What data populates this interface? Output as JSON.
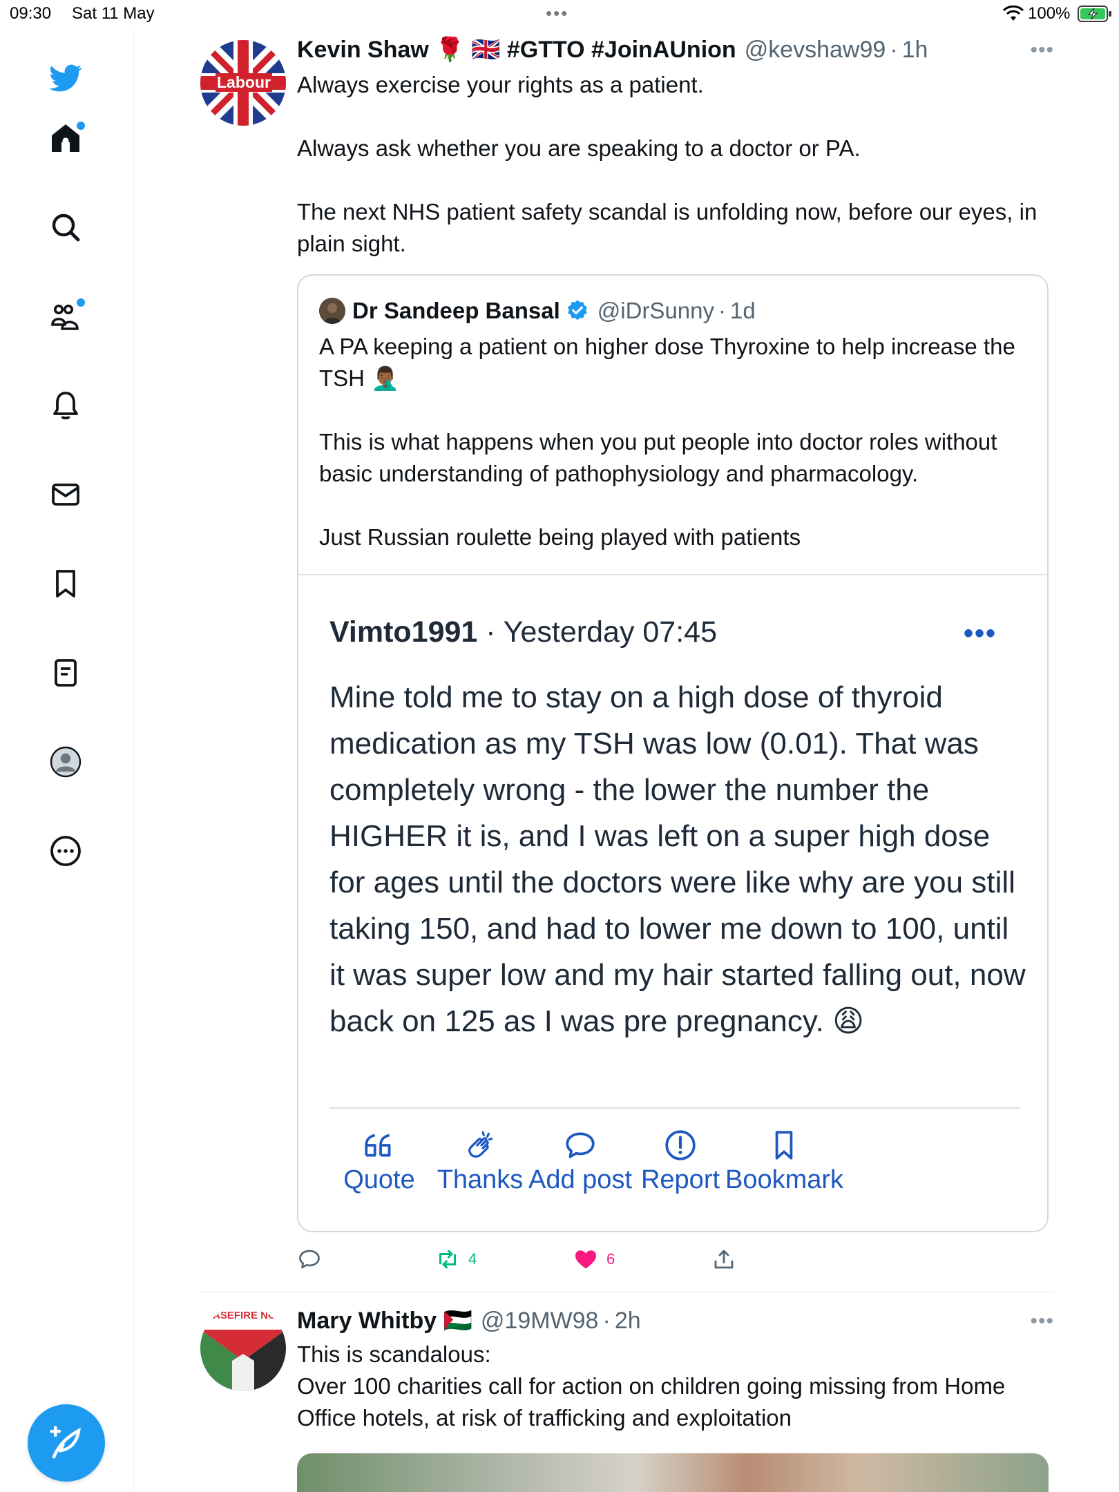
{
  "status_bar": {
    "time": "09:30",
    "date": "Sat 11 May",
    "battery": "100%"
  },
  "colors": {
    "twitter_blue": "#1d9bf0",
    "retweet_green": "#00ba7c",
    "like_pink": "#f91880",
    "embed_blue": "#1d58c2"
  },
  "sidebar": {
    "items": [
      {
        "icon": "twitter-bird-icon"
      },
      {
        "icon": "home-icon"
      },
      {
        "icon": "search-icon"
      },
      {
        "icon": "communities-icon"
      },
      {
        "icon": "notifications-icon"
      },
      {
        "icon": "messages-icon"
      },
      {
        "icon": "bookmarks-icon"
      },
      {
        "icon": "lists-icon"
      },
      {
        "icon": "profile-icon"
      },
      {
        "icon": "more-icon"
      }
    ],
    "compose_icon": "compose-feather-icon"
  },
  "tweet1": {
    "name": "Kevin Shaw 🌹 🇬🇧 #GTTO #JoinAUnion",
    "handle": "@kevshaw99",
    "time": "1h",
    "avatar_text": "Labour",
    "text": "Always exercise your rights as a patient.\n\nAlways ask whether you are speaking to a doctor or PA.\n\nThe next NHS patient safety scandal is unfolding now, before our eyes, in plain sight.",
    "quote": {
      "name": "Dr Sandeep Bansal",
      "handle": "@iDrSunny",
      "time": "1d",
      "text": "A PA keeping a patient on higher dose Thyroxine to help increase the TSH 🤦🏾‍♂️\n\nThis is what happens when you put people into doctor roles without basic understanding of pathophysiology and pharmacology.\n\nJust Russian roulette being played with patients",
      "embed": {
        "username": "Vimto1991",
        "timestamp": "Yesterday 07:45",
        "body": "Mine told me to stay on a high dose of thyroid medication as my TSH was low (0.01). That was completely wrong - the lower the number the HIGHER it is, and I was left on a super high dose for ages until the doctors were like why are you still taking 150, and had to lower me down to 100, until it was super low and my hair started falling out, now back on 125 as I was pre pregnancy. 😩",
        "actions": {
          "quote": "Quote",
          "thanks": "Thanks",
          "add_post": "Add post",
          "report": "Report",
          "bookmark": "Bookmark"
        }
      }
    },
    "stats": {
      "retweets": "4",
      "likes": "6"
    }
  },
  "tweet2": {
    "name": "Mary Whitby 🇵🇸",
    "handle": "@19MW98",
    "time": "2h",
    "avatar_text": "ASEFIRE NC",
    "text": "This is scandalous:\nOver 100 charities call for action on children going missing from Home Office hotels, at risk of trafficking and exploitation"
  }
}
